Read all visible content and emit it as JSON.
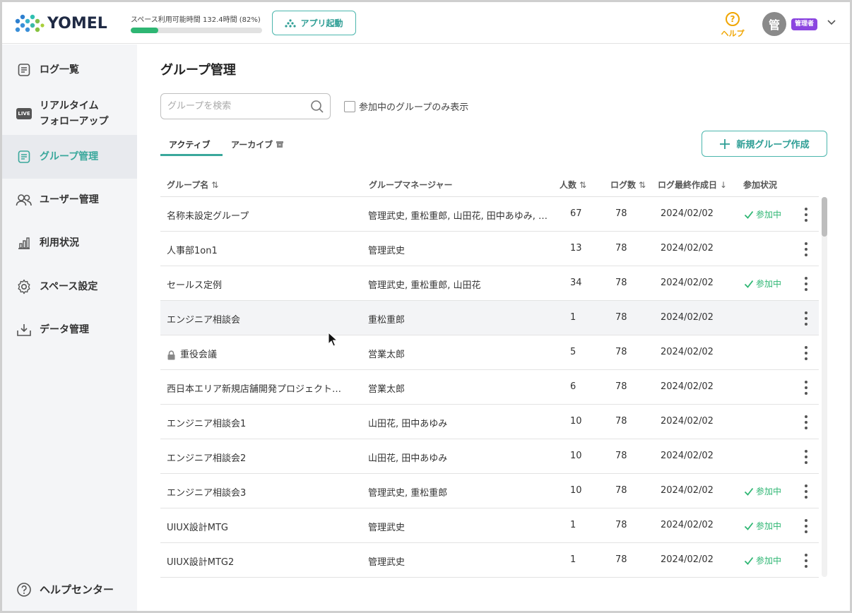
{
  "header": {
    "logo_text": "YOMEL",
    "usage_label": "スペース利用可能時間 132.4時間 (82%)",
    "usage_percent": 21,
    "app_button": "アプリ起動",
    "help_label": "ヘルプ",
    "help_icon": "?",
    "avatar_text": "管",
    "role_badge": "管理者"
  },
  "sidebar": {
    "items": [
      {
        "label": "ログ一覧",
        "icon": "document-icon"
      },
      {
        "label": "リアルタイム\nフォローアップ",
        "icon": "live-icon",
        "badge": "LIVE"
      },
      {
        "label": "グループ管理",
        "icon": "document-icon",
        "active": true
      },
      {
        "label": "ユーザー管理",
        "icon": "users-icon"
      },
      {
        "label": "利用状況",
        "icon": "bar-chart-icon"
      },
      {
        "label": "スペース設定",
        "icon": "gear-icon"
      },
      {
        "label": "データ管理",
        "icon": "download-icon"
      }
    ],
    "help_center": "ヘルプセンター"
  },
  "main": {
    "title": "グループ管理",
    "search_placeholder": "グループを検索",
    "filter_label": "参加中のグループのみ表示",
    "tabs": [
      {
        "label": "アクティブ",
        "active": true
      },
      {
        "label": "アーカイブ",
        "active": false
      }
    ],
    "new_group_button": "新規グループ作成",
    "columns": {
      "name": "グループ名",
      "manager": "グループマネージャー",
      "members": "人数",
      "logs": "ログ数",
      "last_log": "ログ最終作成日",
      "status": "参加状況"
    },
    "rows": [
      {
        "name": "名称未設定グループ",
        "manager": "管理武史, 重松重郎, 山田花, 田中あゆみ, …",
        "members": "67",
        "logs": "78",
        "date": "2024/02/02",
        "status": "参加中"
      },
      {
        "name": "人事部1on1",
        "manager": "管理武史",
        "members": "13",
        "logs": "78",
        "date": "2024/02/02",
        "status": ""
      },
      {
        "name": "セールス定例",
        "manager": "管理武史, 重松重郎, 山田花",
        "members": "34",
        "logs": "78",
        "date": "2024/02/02",
        "status": "参加中"
      },
      {
        "name": "エンジニア相談会",
        "manager": "重松重郎",
        "members": "1",
        "logs": "78",
        "date": "2024/02/02",
        "status": "",
        "hover": true
      },
      {
        "name": "重役会議",
        "manager": "営業太郎",
        "members": "5",
        "logs": "78",
        "date": "2024/02/02",
        "status": "",
        "locked": true
      },
      {
        "name": "西日本エリア新規店舗開発プロジェクト…",
        "manager": "営業太郎",
        "members": "6",
        "logs": "78",
        "date": "2024/02/02",
        "status": ""
      },
      {
        "name": "エンジニア相談会1",
        "manager": "山田花, 田中あゆみ",
        "members": "10",
        "logs": "78",
        "date": "2024/02/02",
        "status": ""
      },
      {
        "name": "エンジニア相談会2",
        "manager": "山田花, 田中あゆみ",
        "members": "10",
        "logs": "78",
        "date": "2024/02/02",
        "status": ""
      },
      {
        "name": "エンジニア相談会3",
        "manager": "管理武史, 重松重郎",
        "members": "10",
        "logs": "78",
        "date": "2024/02/02",
        "status": "参加中"
      },
      {
        "name": "UIUX設計MTG",
        "manager": "管理武史",
        "members": "1",
        "logs": "78",
        "date": "2024/02/02",
        "status": "参加中"
      },
      {
        "name": "UIUX設計MTG2",
        "manager": "管理武史",
        "members": "1",
        "logs": "78",
        "date": "2024/02/02",
        "status": "参加中"
      }
    ]
  },
  "colors": {
    "accent": "#3aa89c",
    "joined": "#2eb673",
    "role_badge": "#8b45e0",
    "help": "#f0a500"
  }
}
